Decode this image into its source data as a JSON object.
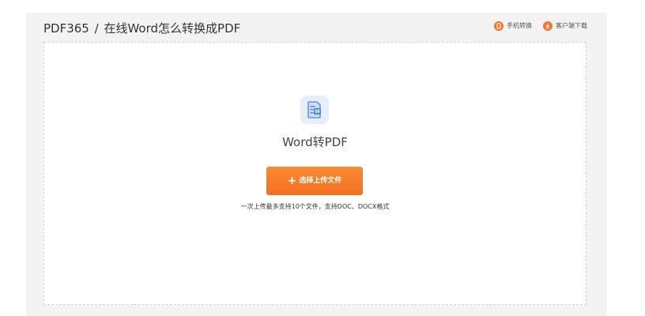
{
  "header": {
    "breadcrumb_home": "PDF365",
    "breadcrumb_separator": "/",
    "breadcrumb_current": "在线Word怎么转换成PDF",
    "links": [
      {
        "label": "手机转换",
        "icon": "phone-icon"
      },
      {
        "label": "客户端下载",
        "icon": "download-icon"
      }
    ]
  },
  "converter": {
    "icon": "word-file-icon",
    "icon_letter": "W",
    "title": "Word转PDF",
    "upload_button": {
      "icon": "plus-icon",
      "plus_glyph": "+",
      "label": "选择上传文件"
    },
    "hint": "一次上传最多支持10个文件，支持DOC、DOCX格式"
  },
  "colors": {
    "accent": "#f4742a",
    "panel_bg": "#f3f3f3",
    "icon_bg": "#e7eefb",
    "icon_fg": "#4a86e8"
  }
}
